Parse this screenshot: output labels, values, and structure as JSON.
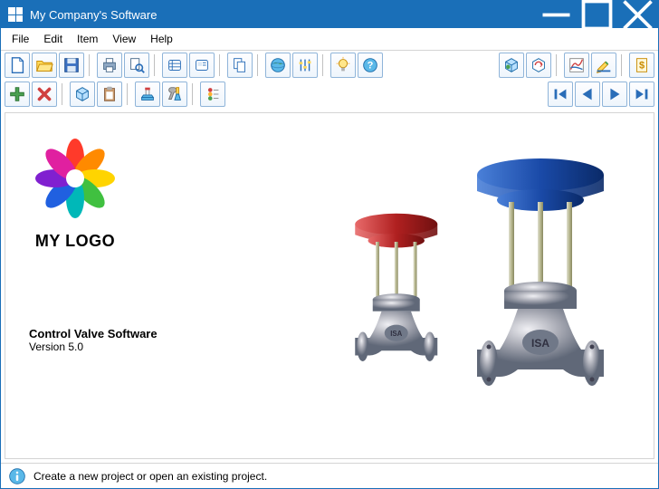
{
  "window": {
    "title": "My Company's Software"
  },
  "menu": {
    "file": "File",
    "edit": "Edit",
    "item": "Item",
    "view": "View",
    "help": "Help"
  },
  "logo": {
    "text": "MY LOGO"
  },
  "product": {
    "name": "Control Valve Software",
    "version": "Version 5.0"
  },
  "status": {
    "message": "Create a new project or open an existing project."
  }
}
